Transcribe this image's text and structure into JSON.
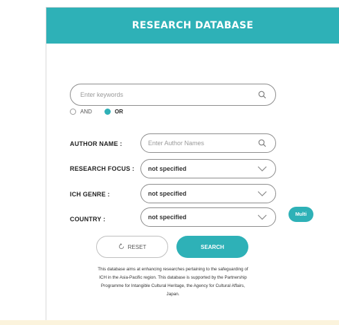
{
  "header": {
    "title": "RESEARCH DATABASE"
  },
  "keyword_search": {
    "placeholder": "Enter keywords"
  },
  "operator": {
    "options": [
      {
        "label": "AND",
        "selected": false
      },
      {
        "label": "OR",
        "selected": true
      }
    ]
  },
  "author": {
    "label": "AUTHOR NAME :",
    "placeholder": "Enter Author Names"
  },
  "research_focus": {
    "label": "RESEARCH FOCUS :",
    "value": "not specified"
  },
  "ich_genre": {
    "label": "ICH GENRE :",
    "value": "not specified"
  },
  "country": {
    "label": "COUNTRY :",
    "value": "not specified"
  },
  "multi_button": {
    "label": "Multi"
  },
  "actions": {
    "reset_label": "RESET",
    "search_label": "SEARCH"
  },
  "description": "This database aims at enhancing researches pertaining to the safeguarding of ICH in the Asia-Pacific region. This database is supported by the Partnership Programme for Intangible Cultural Heritage, the Agency for Cultural Affairs, Japan.",
  "colors": {
    "accent": "#2eb1b7",
    "border": "#8a8a8a",
    "bottom_strip": "#fbf3dc"
  },
  "icons": [
    "search-icon",
    "chevron-down-icon",
    "reset-icon"
  ]
}
